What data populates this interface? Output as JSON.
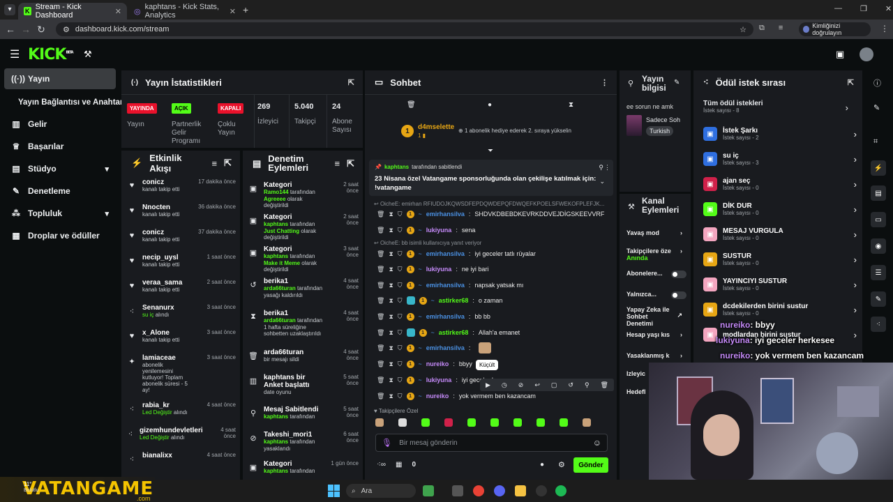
{
  "browser": {
    "tabs": [
      {
        "label": "Stream - Kick Dashboard"
      },
      {
        "label": "kaphtans - Kick Stats, Analytics"
      }
    ],
    "url": "dashboard.kick.com/stream",
    "verify_label": "Kimliğinizi doğrulayın"
  },
  "brand": {
    "logo": "KICK",
    "beta": "BETA",
    "accent": "#53fc18"
  },
  "sidebar": {
    "items": [
      {
        "label": "Yayın",
        "icon": "broadcast-icon"
      },
      {
        "label": "Yayın Bağlantısı ve Anahtarı"
      },
      {
        "label": "Gelir",
        "icon": "chart-icon"
      },
      {
        "label": "Başarılar",
        "icon": "trophy-icon"
      },
      {
        "label": "Stüdyo",
        "icon": "studio-icon"
      },
      {
        "label": "Denetleme",
        "icon": "wrench-icon"
      },
      {
        "label": "Topluluk",
        "icon": "community-icon"
      },
      {
        "label": "Droplar ve ödüller",
        "icon": "gift-icon"
      }
    ]
  },
  "stats": {
    "title": "Yayın İstatistikleri",
    "items": [
      {
        "tag": "YAYINDA",
        "label": "Yayın",
        "tag_color": "#e9112b"
      },
      {
        "tag": "AÇIK",
        "label": "Partnerlik Gelir Programı",
        "tag_color": "#53fc18"
      },
      {
        "tag": "KAPALI",
        "label": "Çoklu Yayın",
        "tag_color": "#e9112b"
      },
      {
        "value": "269",
        "label": "İzleyici"
      },
      {
        "value": "5.040",
        "label": "Takipçi"
      },
      {
        "value": "24",
        "label": "Abone Sayısı"
      }
    ]
  },
  "activity": {
    "title": "Etkinlik Akışı",
    "rows": [
      {
        "name": "conicz",
        "sub": "kanalı takip etti",
        "time": "17 dakika önce",
        "icon": "heart-icon"
      },
      {
        "name": "Nnocten",
        "sub": "kanalı takip etti",
        "time": "36 dakika önce",
        "icon": "heart-icon"
      },
      {
        "name": "conicz",
        "sub": "kanalı takip etti",
        "time": "37 dakika önce",
        "icon": "heart-icon"
      },
      {
        "name": "necip_uysl",
        "sub": "kanalı takip etti",
        "time": "1 saat önce",
        "icon": "heart-icon"
      },
      {
        "name": "veraa_sama",
        "sub": "kanalı takip etti",
        "time": "2 saat önce",
        "icon": "heart-icon"
      },
      {
        "name": "Senanurx",
        "sub_green": "su iç",
        "sub": "alındı",
        "time": "3 saat önce",
        "icon": "points-icon"
      },
      {
        "name": "x_Alone",
        "sub": "kanalı takip etti",
        "time": "3 saat önce",
        "icon": "heart-icon"
      },
      {
        "name": "lamiaceae",
        "sub": "abonelik yenilemesini kutluyor! Toplam abonelik süresi - 5 ay!",
        "time": "3 saat önce",
        "icon": "star-icon"
      },
      {
        "name": "rabia_kr",
        "sub_green": "Led Değiştir",
        "sub": "alındı",
        "time": "4 saat önce",
        "icon": "points-icon"
      },
      {
        "name": "gizemhundevletleri",
        "sub_green": "Led Değiştir",
        "sub": "alındı",
        "time": "4 saat önce",
        "icon": "points-icon"
      },
      {
        "name": "bianalixx",
        "sub": "",
        "time": "4 saat önce",
        "icon": "points-icon"
      }
    ]
  },
  "moderation": {
    "title": "Denetim Eylemleri",
    "rows": [
      {
        "title": "Kategori",
        "time": "2 saat önce",
        "actor": "Ramo144",
        "mid": "tarafından",
        "target": "Agreeee",
        "tail": "olarak değiştirildi"
      },
      {
        "title": "Kategori",
        "time": "2 saat önce",
        "actor": "kaphtans",
        "mid": "tarafından",
        "target": "Just Chatting",
        "tail": "olarak değiştirildi"
      },
      {
        "title": "Kategori",
        "time": "3 saat önce",
        "actor": "kaphtans",
        "mid": "tarafından",
        "target": "Make it Meme",
        "tail": "olarak değiştirildi"
      },
      {
        "title": "berika1",
        "time": "4 saat önce",
        "actor": "arda66turan",
        "mid": "tarafından yasağı kaldırıldı",
        "target": "",
        "tail": ""
      },
      {
        "title": "berika1",
        "time": "4 saat önce",
        "actor": "arda66turan",
        "mid": "tarafından 1 hafta süreliğine sohbetten uzaklaştırıldı",
        "target": "",
        "tail": ""
      },
      {
        "title": "arda66turan",
        "time": "4 saat önce",
        "actor": "",
        "mid": "bir mesajı sildi",
        "target": "",
        "tail": ""
      },
      {
        "title": "kaphtans bir Anket başlattı",
        "time": "5 saat önce",
        "actor": "",
        "mid": "date oyunu",
        "target": "",
        "tail": ""
      },
      {
        "title": "Mesaj Sabitlendi",
        "time": "5 saat önce",
        "actor": "kaphtans",
        "mid": "tarafından",
        "target": "",
        "tail": ""
      },
      {
        "title": "Takeshi_mori1",
        "time": "6 saat önce",
        "actor": "kaphtans",
        "mid": "tarafından yasaklandı",
        "target": "",
        "tail": ""
      },
      {
        "title": "Kategori",
        "time": "1 gün önce",
        "actor": "kaphtans",
        "mid": "tarafından",
        "target": "",
        "tail": ""
      }
    ]
  },
  "chat": {
    "title": "Sohbet",
    "gift": {
      "user": "d4mselette",
      "badge": "1",
      "text": "1 abonelik hediye ederek 2. sıraya yükselin"
    },
    "pinned": {
      "by": "kaphtans",
      "by_suffix": "tarafından sabitlendi",
      "text": "23 Nisana özel Vatangame sponsorluğunda olan çekilişe katılmak için: !vatangame"
    },
    "reply_hint_1": "OicheE: emirhan RFIUDOJKQWSDFEPDQWDEPQFDWQEFKPOELSFWEKOFPLEFJK...",
    "reply_hint_2": "OicheE: bb isimli kullanıcıya yanıt veriyor",
    "messages": [
      {
        "user": "emirhansilva",
        "color": "#4a90e2",
        "text": "SHDVKDBEBDKEVRKDDVEJDİGSKEEVVRF"
      },
      {
        "user": "lukiyuna",
        "color": "#c58af9",
        "text": "sena"
      },
      {
        "user": "emirhansilva",
        "color": "#4a90e2",
        "text": "iyi geceler tatlı rüyalar"
      },
      {
        "user": "lukiyuna",
        "color": "#c58af9",
        "text": "ne iyi bari"
      },
      {
        "user": "emirhansilva",
        "color": "#4a90e2",
        "text": "napsak yatsak mı"
      },
      {
        "user": "astirker68",
        "color": "#53fc18",
        "text": "o zaman"
      },
      {
        "user": "emirhansilva",
        "color": "#4a90e2",
        "text": "bb bb"
      },
      {
        "user": "astirker68",
        "color": "#53fc18",
        "text": "Allah'a emanet"
      },
      {
        "user": "emirhansilva",
        "color": "#4a90e2",
        "text": ""
      },
      {
        "user": "nureiko",
        "color": "#c58af9",
        "text": "bbyy"
      },
      {
        "user": "lukiyuna",
        "color": "#c58af9",
        "text": "iyi geceler her"
      },
      {
        "user": "nureiko",
        "color": "#c58af9",
        "text": "yok vermem ben kazancam"
      }
    ],
    "tooltip": "Küçült",
    "emote_label": "Takipçilere Özel",
    "input_placeholder": "Bir mesaj gönderin",
    "points": "0",
    "send_label": "Gönder"
  },
  "stream_info": {
    "title": "Yayın bilgisi",
    "text": "ee sorun ne amk",
    "sub_title": "Sadece Soh",
    "tag": "Turkish"
  },
  "channel_actions": {
    "title": "Kanal Eylemleri",
    "items": [
      {
        "label": "Yavaş mod"
      },
      {
        "label": "Takipçilere öze",
        "sub": "Anında"
      },
      {
        "label": "Abonelere..."
      },
      {
        "label": "Yalnızca..."
      },
      {
        "label": "Yapay Zeka ile Sohbet Denetimi"
      },
      {
        "label": "Hesap yaşı kıs"
      },
      {
        "label": "Yasaklanmış k"
      },
      {
        "label": "İzleyic"
      },
      {
        "label": "Hedefl"
      }
    ]
  },
  "rewards": {
    "title": "Ödül istek sırası",
    "all_label": "Tüm ödül istekleri",
    "all_sub": "İstek sayısı - 8",
    "rows": [
      {
        "label": "İstek Şarkı",
        "sub": "İstek sayısı - 2",
        "color": "#2f6fe0"
      },
      {
        "label": "su iç",
        "sub": "İstek sayısı - 3",
        "color": "#2f6fe0"
      },
      {
        "label": "ajan seç",
        "sub": "İstek sayısı - 0",
        "color": "#d0214a"
      },
      {
        "label": "DİK DUR",
        "sub": "İstek sayısı - 0",
        "color": "#53fc18"
      },
      {
        "label": "MESAJ VURGULA",
        "sub": "İstek sayısı - 0",
        "color": "#f4a6c0"
      },
      {
        "label": "SUSTUR",
        "sub": "İstek sayısı - 0",
        "color": "#e7a614"
      },
      {
        "label": "YAYINCIYI SUSTUR",
        "sub": "İstek sayısı - 0",
        "color": "#f4a6c0"
      },
      {
        "label": "dcdekilerden birini sustur",
        "sub": "İstek sayısı - 0",
        "color": "#e7a614"
      },
      {
        "label": "modlardan birini sustur",
        "sub": "",
        "color": "#f4a6c0"
      }
    ]
  },
  "overlay_chat": [
    {
      "user": "nureiko",
      "text": ": bbyy"
    },
    {
      "user": "lukiyuna",
      "text": ": iyi geceler herkesee"
    },
    {
      "user": "nureiko",
      "text": ": yok vermem ben kazancam"
    }
  ],
  "taskbar": {
    "search": "Ara",
    "weather": "11°",
    "weather_sub": "Bulutlu",
    "sponsor": "VATANGAME",
    "sponsor_sub": ".com"
  }
}
